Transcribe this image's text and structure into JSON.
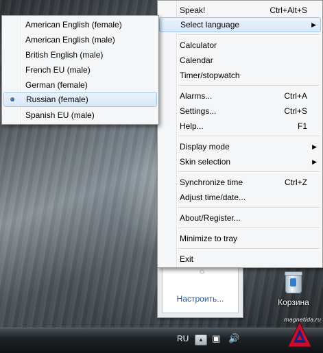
{
  "main_menu": {
    "speak": {
      "label": "Speak!",
      "shortcut": "Ctrl+Alt+S"
    },
    "select_language": {
      "label": "Select language"
    },
    "calculator": {
      "label": "Calculator"
    },
    "calendar": {
      "label": "Calendar"
    },
    "timer": {
      "label": "Timer/stopwatch"
    },
    "alarms": {
      "label": "Alarms...",
      "shortcut": "Ctrl+A"
    },
    "settings": {
      "label": "Settings...",
      "shortcut": "Ctrl+S"
    },
    "help": {
      "label": "Help...",
      "shortcut": "F1"
    },
    "display_mode": {
      "label": "Display mode"
    },
    "skin_selection": {
      "label": "Skin selection"
    },
    "sync_time": {
      "label": "Synchronize time",
      "shortcut": "Ctrl+Z"
    },
    "adjust_time": {
      "label": "Adjust time/date..."
    },
    "about": {
      "label": "About/Register..."
    },
    "minimize": {
      "label": "Minimize to tray"
    },
    "exit": {
      "label": "Exit"
    }
  },
  "language_submenu": {
    "items": [
      "American English (female)",
      "American English (male)",
      "British English (male)",
      "French EU (male)",
      "German (female)",
      "Russian (female)",
      "Spanish EU (male)"
    ],
    "selected": "Russian (female)"
  },
  "gadget": {
    "link": "Настроить..."
  },
  "desktop": {
    "recycle_bin_label": "Корзина",
    "watermark": "magnetida.ru"
  },
  "taskbar": {
    "language": "RU"
  },
  "colors": {
    "highlight_bg": "#d8e8f9",
    "highlight_border": "#a8c8ec",
    "menu_bg": "#f5f6f7",
    "link": "#1e55a8"
  }
}
